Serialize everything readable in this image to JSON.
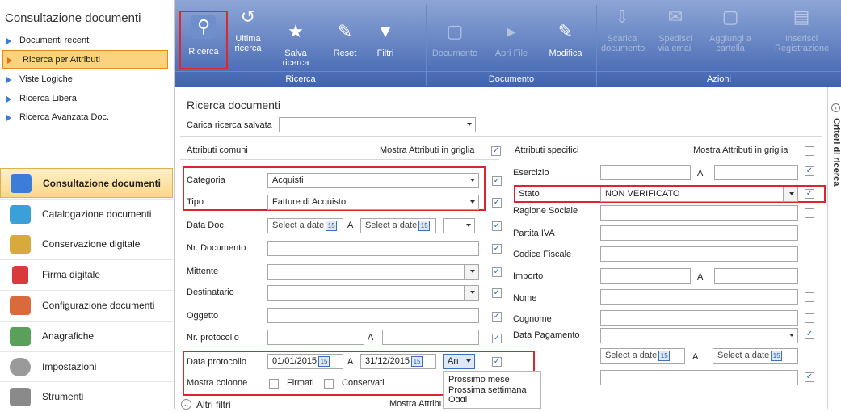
{
  "sidebar": {
    "title": "Consultazione documenti",
    "nav": [
      {
        "label": "Documenti recenti"
      },
      {
        "label": "Ricerca per Attributi"
      },
      {
        "label": "Viste Logiche"
      },
      {
        "label": "Ricerca Libera"
      },
      {
        "label": "Ricerca Avanzata Doc."
      }
    ],
    "modules": [
      {
        "label": "Consultazione documenti",
        "icon": "book-icon",
        "color": "#3b7dd8"
      },
      {
        "label": "Catalogazione documenti",
        "icon": "upload-icon",
        "color": "#3ba0d8"
      },
      {
        "label": "Conservazione digitale",
        "icon": "archive-icon",
        "color": "#d8a93b"
      },
      {
        "label": "Firma digitale",
        "icon": "ribbon-badge-icon",
        "color": "#d83b3b"
      },
      {
        "label": "Configurazione documenti",
        "icon": "cubes-icon",
        "color": "#d86a3b"
      },
      {
        "label": "Anagrafiche",
        "icon": "table-icon",
        "color": "#5aa05a"
      },
      {
        "label": "Impostazioni",
        "icon": "gear-icon",
        "color": "#9a9a9a"
      },
      {
        "label": "Strumenti",
        "icon": "tools-icon",
        "color": "#8a8a8a"
      }
    ]
  },
  "ribbon": {
    "buttons": {
      "ricerca": "Ricerca",
      "ultima": "Ultima ricerca",
      "salva": "Salva ricerca",
      "reset": "Reset",
      "filtri": "Filtri",
      "documento": "Documento",
      "apri": "Apri File",
      "modifica": "Modifica",
      "scarica": "Scarica documento",
      "spedisci": "Spedisci via email",
      "aggiungi": "Aggiungi a cartella",
      "inserisci": "Inserisci Registrazione"
    },
    "groups": {
      "ricerca": "Ricerca",
      "documento": "Documento",
      "azioni": "Azioni"
    }
  },
  "content": {
    "title": "Ricerca documenti",
    "load_label": "Carica ricerca salvata",
    "common_header": "Attributi comuni",
    "common_grid": "Mostra Attributi in griglia",
    "specific_header": "Attributi specifici",
    "specific_grid": "Mostra Attributi in griglia",
    "left": {
      "categoria": {
        "label": "Categoria",
        "value": "Acquisti"
      },
      "tipo": {
        "label": "Tipo",
        "value": "Fatture di Acquisto"
      },
      "datadoc": {
        "label": "Data Doc.",
        "from": "Select a date",
        "sep": "A",
        "to": "Select a date"
      },
      "nrdoc": {
        "label": "Nr. Documento"
      },
      "mittente": {
        "label": "Mittente"
      },
      "destinatario": {
        "label": "Destinatario"
      },
      "oggetto": {
        "label": "Oggetto"
      },
      "nrprot": {
        "label": "Nr. protocollo",
        "sep": "A"
      },
      "dataprot": {
        "label": "Data protocollo",
        "from": "01/01/2015",
        "sep": "A",
        "to": "31/12/2015",
        "period": "An"
      },
      "mostra": {
        "label": "Mostra colonne",
        "firmati": "Firmati",
        "conservati": "Conservati"
      },
      "altri": {
        "label": "Altri filtri",
        "grid": "Mostra Attributi"
      }
    },
    "right": {
      "esercizio": {
        "label": "Esercizio",
        "sep": "A"
      },
      "stato": {
        "label": "Stato",
        "value": "NON VERIFICATO"
      },
      "ragione": {
        "label": "Ragione Sociale"
      },
      "piva": {
        "label": "Partita IVA"
      },
      "cf": {
        "label": "Codice Fiscale"
      },
      "importo": {
        "label": "Importo",
        "sep": "A"
      },
      "nome": {
        "label": "Nome"
      },
      "cognome": {
        "label": "Cognome"
      },
      "datapag": {
        "label": "Data Pagamento"
      },
      "daterange": {
        "from": "Select a date",
        "sep": "A",
        "to": "Select a date"
      }
    },
    "popup": [
      "Prossimo mese",
      "Prossima settimana",
      "Oggi"
    ],
    "side_tab": "Criteri di ricerca",
    "cal_day": "15"
  },
  "colors": {
    "ribbon_top": "#8ea6d6",
    "ribbon_bottom": "#3f63b0",
    "highlight": "#d9262d",
    "selected_nav": "#fbd27d"
  }
}
